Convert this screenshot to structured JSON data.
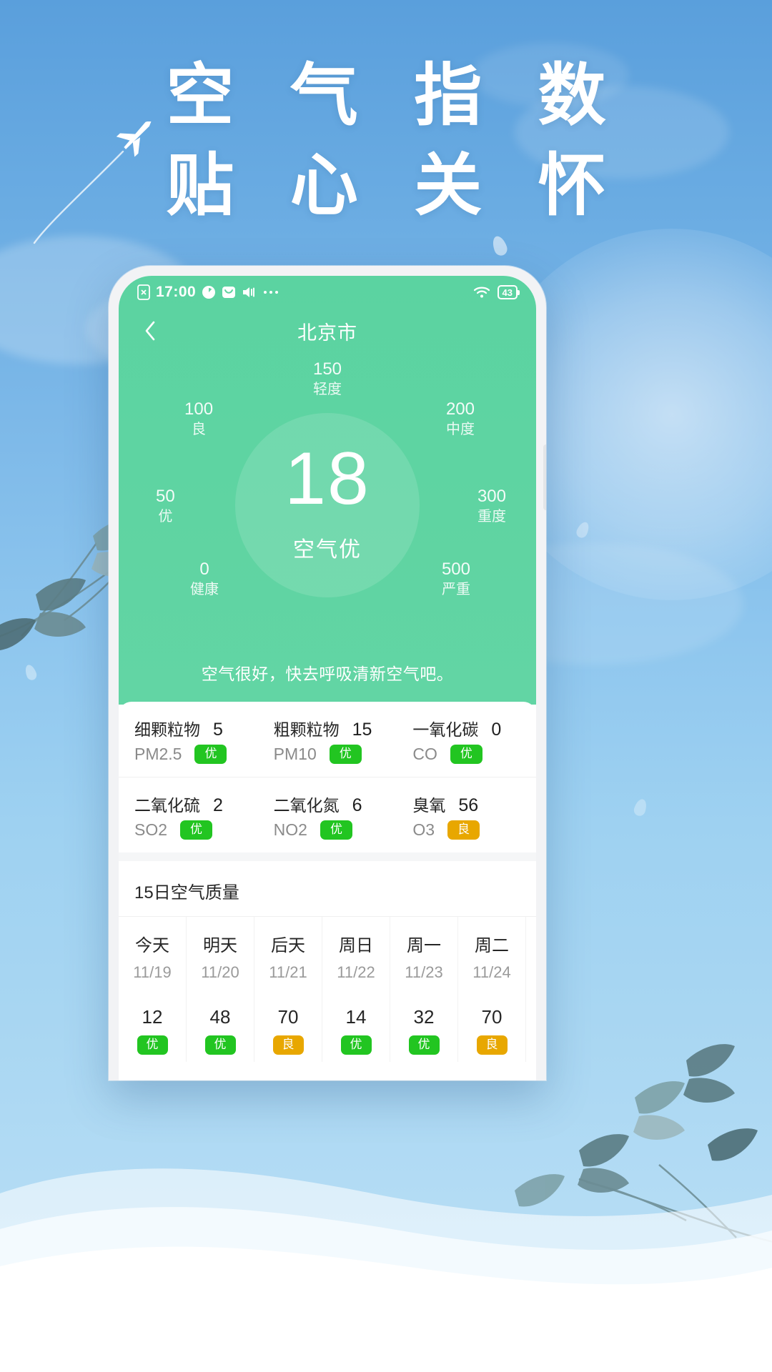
{
  "poster": {
    "headline_line1": "空 气 指 数",
    "headline_line2": "贴 心 关 怀",
    "plane_icon": "airplane-icon"
  },
  "statusbar": {
    "sim_icon": "sim-card-off-icon",
    "time": "17:00",
    "clock_icon": "clock-icon",
    "mail_icon": "mail-icon",
    "mute_icon": "speaker-mute-icon",
    "more_icon": "more-dots-icon",
    "wifi_icon": "wifi-icon",
    "battery_level": "43"
  },
  "navbar": {
    "back_icon": "chevron-left-icon",
    "title": "北京市"
  },
  "gauge": {
    "aqi_value": "18",
    "aqi_label": "空气优",
    "ticks": [
      {
        "value": "0",
        "label": "健康"
      },
      {
        "value": "50",
        "label": "优"
      },
      {
        "value": "100",
        "label": "良"
      },
      {
        "value": "150",
        "label": "轻度"
      },
      {
        "value": "200",
        "label": "中度"
      },
      {
        "value": "300",
        "label": "重度"
      },
      {
        "value": "500",
        "label": "严重"
      }
    ],
    "advice": "空气很好，快去呼吸清新空气吧。"
  },
  "pollutants": [
    {
      "name": "细颗粒物",
      "code": "PM2.5",
      "value": "5",
      "badge": "优",
      "badge_color": "#22c521"
    },
    {
      "name": "粗颗粒物",
      "code": "PM10",
      "value": "15",
      "badge": "优",
      "badge_color": "#22c521"
    },
    {
      "name": "一氧化碳",
      "code": "CO",
      "value": "0",
      "badge": "优",
      "badge_color": "#22c521"
    },
    {
      "name": "二氧化硫",
      "code": "SO2",
      "value": "2",
      "badge": "优",
      "badge_color": "#22c521"
    },
    {
      "name": "二氧化氮",
      "code": "NO2",
      "value": "6",
      "badge": "优",
      "badge_color": "#22c521"
    },
    {
      "name": "臭氧",
      "code": "O3",
      "value": "56",
      "badge": "良",
      "badge_color": "#e8a700"
    }
  ],
  "forecast": {
    "title": "15日空气质量",
    "days": [
      {
        "day": "今天",
        "date": "11/19",
        "aqi": "12",
        "badge": "优",
        "badge_color": "#22c521"
      },
      {
        "day": "明天",
        "date": "11/20",
        "aqi": "48",
        "badge": "优",
        "badge_color": "#22c521"
      },
      {
        "day": "后天",
        "date": "11/21",
        "aqi": "70",
        "badge": "良",
        "badge_color": "#e8a700"
      },
      {
        "day": "周日",
        "date": "11/22",
        "aqi": "14",
        "badge": "优",
        "badge_color": "#22c521"
      },
      {
        "day": "周一",
        "date": "11/23",
        "aqi": "32",
        "badge": "优",
        "badge_color": "#22c521"
      },
      {
        "day": "周二",
        "date": "11/24",
        "aqi": "70",
        "badge": "良",
        "badge_color": "#e8a700"
      }
    ]
  },
  "theme": {
    "sky_top": "#5a9fdc",
    "sky_bottom": "#bfe2f7",
    "panel_green": "#5ed3a0",
    "good_green": "#22c521",
    "moderate_yellow": "#e8a700"
  }
}
